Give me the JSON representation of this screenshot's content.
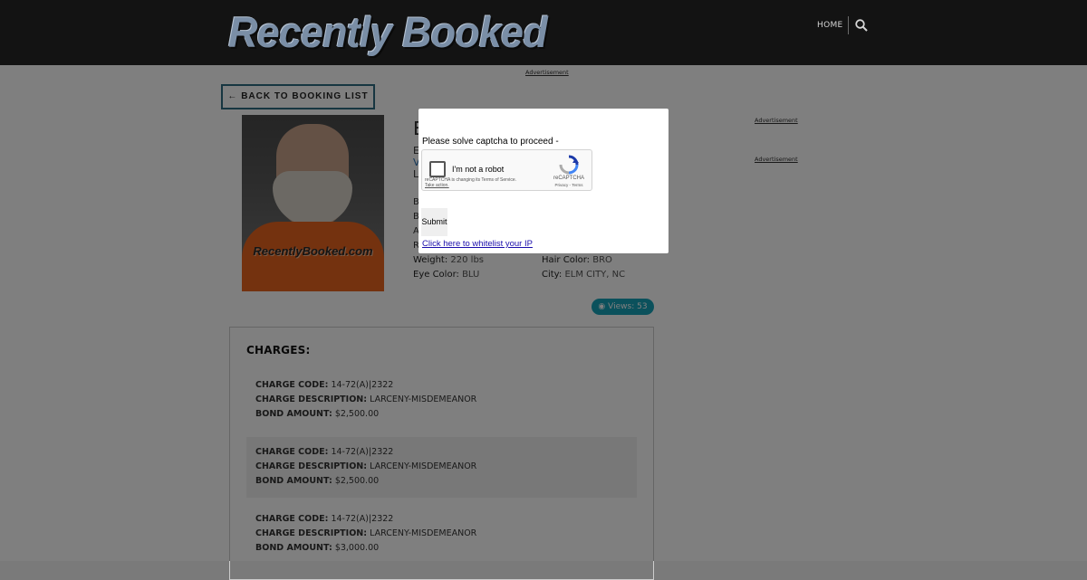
{
  "header": {
    "logo_text": "Recently Booked",
    "nav_home": "HOME"
  },
  "ads": {
    "top": "Advertisement",
    "right_1": "Advertisement",
    "right_2": "Advertisement"
  },
  "back_button": {
    "label": "BACK TO BOOKING LIST",
    "icon": "arrow-left-icon"
  },
  "mugshot": {
    "watermark": "RecentlyBooked.com"
  },
  "profile": {
    "name_initial": "E",
    "partial_lines": [
      "E",
      "V",
      "L"
    ],
    "row_initials": [
      "B",
      "B",
      "A",
      "R"
    ],
    "weight_label": "Weight:",
    "weight_value": "220 lbs",
    "hair_label": "Hair Color:",
    "hair_value": "BRO",
    "eye_label": "Eye Color:",
    "eye_value": "BLU",
    "city_label": "City:",
    "city_value": "ELM CITY, NC"
  },
  "views": {
    "label": "Views: 53",
    "icon": "eye-icon"
  },
  "charges": {
    "title": "CHARGES:",
    "code_label": "CHARGE CODE:",
    "desc_label": "CHARGE DESCRIPTION:",
    "bond_label": "BOND AMOUNT:",
    "items": [
      {
        "code": "14-72(A)|2322",
        "description": "LARCENY-MISDEMEANOR",
        "bond": "$2,500.00"
      },
      {
        "code": "14-72(A)|2322",
        "description": "LARCENY-MISDEMEANOR",
        "bond": "$2,500.00"
      },
      {
        "code": "14-72(A)|2322",
        "description": "LARCENY-MISDEMEANOR",
        "bond": "$3,000.00"
      }
    ]
  },
  "captcha_modal": {
    "message": "Please solve captcha to proceed -",
    "checkbox_label": "I'm not a robot",
    "fine_print": "reCAPTCHA is changing its Terms of Service.",
    "fine_print_link": "Take action.",
    "brand": "reCAPTCHA",
    "links": "Privacy - Terms",
    "submit_label": "Submit",
    "whitelist_link": "Click here to whitelist your IP"
  },
  "colors": {
    "header_bg": "#131313",
    "accent_teal": "#17a2b8",
    "back_button_border": "#2e6c82",
    "mugshot_shirt": "#e8651e"
  }
}
